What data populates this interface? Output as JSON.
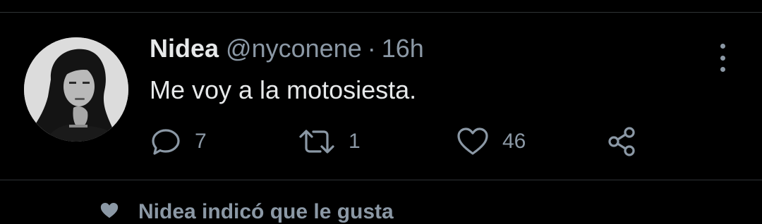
{
  "tweet": {
    "author_name": "Nidea",
    "handle": "@nyconene",
    "separator": "·",
    "time": "16h",
    "text": "Me voy a la motosiesta.",
    "actions": {
      "reply": {
        "icon": "reply-icon",
        "count": "7"
      },
      "retweet": {
        "icon": "retweet-icon",
        "count": "1"
      },
      "like": {
        "icon": "heart-icon",
        "count": "46"
      },
      "share": {
        "icon": "share-icon"
      }
    },
    "more_icon": "more-options-icon"
  },
  "social_context": {
    "icon": "heart-icon",
    "text": "Nidea indicó que le gusta"
  },
  "colors": {
    "background": "#000000",
    "primary_text": "#e7e9ea",
    "secondary_text": "#8b98a5",
    "divider": "#2f3336"
  }
}
